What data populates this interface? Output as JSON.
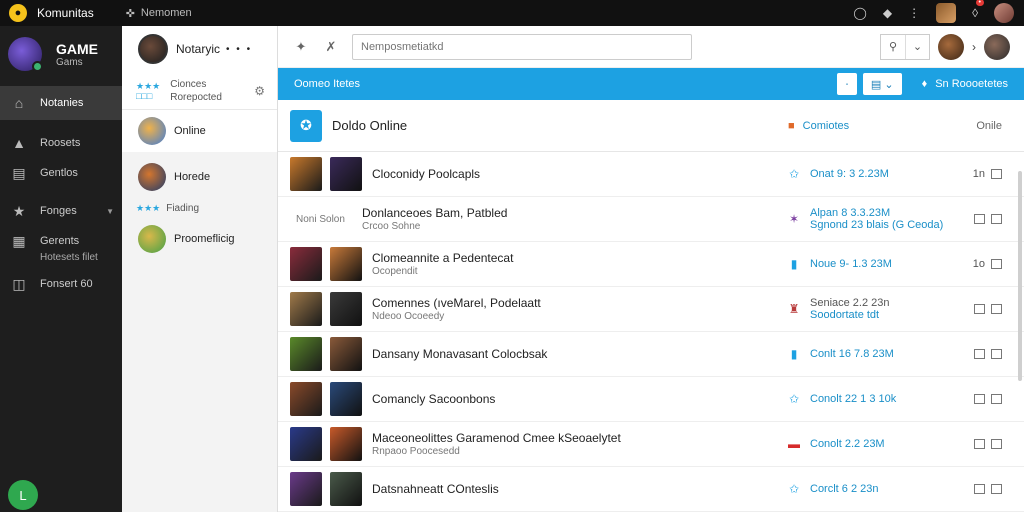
{
  "topbar": {
    "app_title": "Komunitas",
    "nav_link": "Nemomen"
  },
  "sidebar": {
    "brand": "GAME",
    "brand_sub": "Gams",
    "items": [
      {
        "label": "Notanies",
        "icon": "home-icon"
      },
      {
        "label": "Roosets",
        "icon": "house-icon"
      },
      {
        "label": "Gentlos",
        "icon": "monitor-icon"
      },
      {
        "label": "Fonges",
        "icon": "star-icon"
      },
      {
        "label": "Gerents",
        "icon": "chart-icon"
      },
      {
        "label": "Fonsert 60",
        "icon": "box-icon"
      }
    ],
    "sub_label": "Hotesets filet",
    "bottom_badge": "L"
  },
  "friends": {
    "header_name": "Notaryic",
    "status_line1": "Cionces",
    "status_line2": "Rorepocted",
    "items": [
      {
        "label": "Online",
        "color": "#3e7bd6"
      },
      {
        "label": "Horede",
        "color": "#d4762e"
      },
      {
        "label": "Proomeflicig",
        "color": "#43a047"
      }
    ],
    "sub_label": "Fiading"
  },
  "main": {
    "search_placeholder": "Nemposmetiatkd",
    "blue_bar_label": "Oomeo Itetes",
    "blue_bar_right": "Sn Roooetetes",
    "list_title": "Doldo Online",
    "list_mid": "Comiotes",
    "list_end": "Onile",
    "rows": [
      {
        "name": "Cloconidy Poolcapls",
        "sub": "",
        "stat1": "Onat 9: 3 2.23M",
        "stat2": "",
        "icon": "star-outline-icon",
        "icon_color": "#1da1e2",
        "end": "1n",
        "c1": "#c8792c",
        "c2": "#3a2a5a"
      },
      {
        "name": "Donlanceoes Bam, Patbled",
        "sub": "Crcoo Sohne",
        "stat1": "Alpan 8 3.3.23M",
        "stat2": "Sgnond 23 blais (G Ceoda)",
        "icon": "sparkle-icon",
        "icon_color": "#7b3fa0",
        "end": "",
        "c1": "",
        "c2": "",
        "prefix": "Noni  Solon"
      },
      {
        "name": "Clomeannite a Pedentecat",
        "sub": "Ocopendit",
        "stat1": "Noue 9- 1.3 23M",
        "stat2": "",
        "icon": "controller-icon",
        "icon_color": "#1da1e2",
        "end": "1o",
        "c1": "#8a2c3c",
        "c2": "#c87a3a"
      },
      {
        "name": "Comennes (ıveMarel, Podelaatt",
        "sub": "Ndeoo Ocoeedy",
        "stat1": "Seniace 2.2 23n",
        "stat2": "Soodortate tdt",
        "icon": "crown-icon",
        "icon_color": "#b83a3a",
        "end": "",
        "c1": "#a07a4a",
        "c2": "#3a3a3a"
      },
      {
        "name": "Dansany Monavasant Colocbsak",
        "sub": "",
        "stat1": "Conlt 16 7.8 23M",
        "stat2": "",
        "icon": "controller-icon",
        "icon_color": "#1da1e2",
        "end": "",
        "c1": "#5a8a2a",
        "c2": "#8a5a3a"
      },
      {
        "name": "Comancly Sacoonbons",
        "sub": "",
        "stat1": "Conolt 22 1 3 10k",
        "stat2": "",
        "icon": "star-outline-icon",
        "icon_color": "#1da1e2",
        "end": "",
        "c1": "#8a4a2a",
        "c2": "#2a4a7a"
      },
      {
        "name": "Maceoneolittes Garamenod Cmee kSeoaelytet",
        "sub": "Rnpaoo Poocesedd",
        "stat1": "Conolt 2.2 23M",
        "stat2": "",
        "icon": "battery-icon",
        "icon_color": "#d62b2b",
        "end": "",
        "c1": "#2a3a8a",
        "c2": "#c85a2a"
      },
      {
        "name": "Datsnahneatt COnteslis",
        "sub": "",
        "stat1": "Corclt 6 2 23n",
        "stat2": "",
        "icon": "star-outline-icon",
        "icon_color": "#1da1e2",
        "end": "",
        "c1": "#6a3a8a",
        "c2": "#4a5a4a"
      }
    ]
  }
}
